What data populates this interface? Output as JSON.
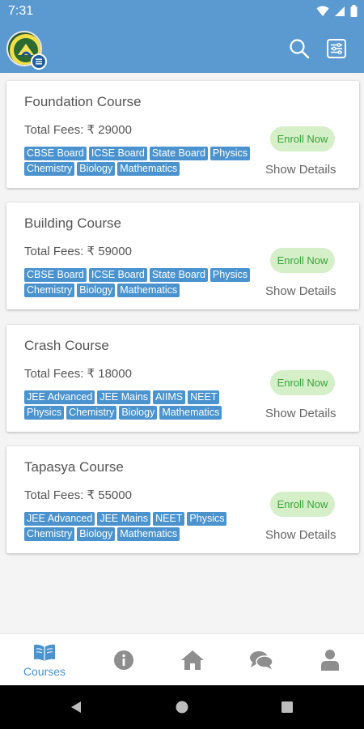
{
  "status_bar": {
    "time": "7:31"
  },
  "colors": {
    "primary": "#5b9ad0",
    "tag": "#4a93cf",
    "enroll_bg": "#d5efc9",
    "enroll_text": "#3aa33a"
  },
  "app_bar": {
    "icons": [
      "logo",
      "menu-icon",
      "search-icon",
      "filter-icon"
    ]
  },
  "courses": [
    {
      "title": "Foundation Course",
      "fees": "Total Fees: ₹ 29000",
      "tags": [
        "CBSE Board",
        "ICSE Board",
        "State Board",
        "Physics",
        "Chemistry",
        "Biology",
        "Mathematics"
      ],
      "enroll_label": "Enroll Now",
      "details_label": "Show Details"
    },
    {
      "title": "Building Course",
      "fees": "Total Fees: ₹ 59000",
      "tags": [
        "CBSE Board",
        "ICSE Board",
        "State Board",
        "Physics",
        "Chemistry",
        "Biology",
        "Mathematics"
      ],
      "enroll_label": "Enroll Now",
      "details_label": "Show Details"
    },
    {
      "title": "Crash Course",
      "fees": "Total Fees: ₹ 18000",
      "tags": [
        "JEE Advanced",
        "JEE Mains",
        "AIIMS",
        "NEET",
        "Physics",
        "Chemistry",
        "Biology",
        "Mathematics"
      ],
      "enroll_label": "Enroll Now",
      "details_label": "Show Details"
    },
    {
      "title": "Tapasya Course",
      "fees": "Total Fees: ₹ 55000",
      "tags": [
        "JEE Advanced",
        "JEE Mains",
        "NEET",
        "Physics",
        "Chemistry",
        "Biology",
        "Mathematics"
      ],
      "enroll_label": "Enroll Now",
      "details_label": "Show Details"
    }
  ],
  "bottom_nav": {
    "items": [
      {
        "icon": "book-icon",
        "label": "Courses",
        "active": true
      },
      {
        "icon": "info-icon",
        "label": "",
        "active": false
      },
      {
        "icon": "home-icon",
        "label": "",
        "active": false
      },
      {
        "icon": "chat-icon",
        "label": "",
        "active": false
      },
      {
        "icon": "profile-icon",
        "label": "",
        "active": false
      }
    ]
  }
}
